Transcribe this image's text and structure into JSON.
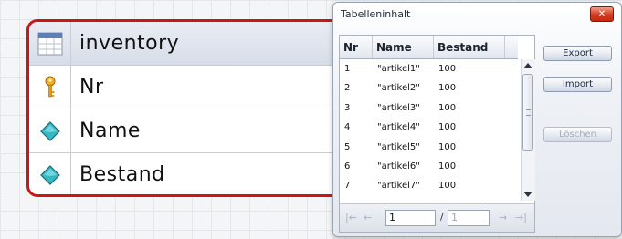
{
  "entity": {
    "name": "inventory",
    "fields": [
      {
        "label": "Nr",
        "icon": "key-icon"
      },
      {
        "label": "Name",
        "icon": "attribute-diamond-icon"
      },
      {
        "label": "Bestand",
        "icon": "attribute-diamond-icon"
      }
    ]
  },
  "dialog": {
    "title": "Tabelleninhalt",
    "close_label": "✕",
    "table": {
      "columns": [
        "Nr",
        "Name",
        "Bestand"
      ],
      "rows": [
        [
          "1",
          "\"artikel1\"",
          "100"
        ],
        [
          "2",
          "\"artikel2\"",
          "100"
        ],
        [
          "3",
          "\"artikel3\"",
          "100"
        ],
        [
          "4",
          "\"artikel4\"",
          "100"
        ],
        [
          "5",
          "\"artikel5\"",
          "100"
        ],
        [
          "6",
          "\"artikel6\"",
          "100"
        ],
        [
          "7",
          "\"artikel7\"",
          "100"
        ]
      ]
    },
    "pager": {
      "first": "|←",
      "prev": "←",
      "current_page": "1",
      "separator": "/",
      "total_pages": "1",
      "next": "→",
      "last": "→|"
    },
    "buttons": {
      "export": "Export",
      "import": "Import",
      "delete": "Löschen"
    }
  },
  "colors": {
    "entity_border": "#cc1616",
    "key_icon": "#e09a1c",
    "attribute_icon": "#34b8c2",
    "close_button": "#d5391c"
  }
}
